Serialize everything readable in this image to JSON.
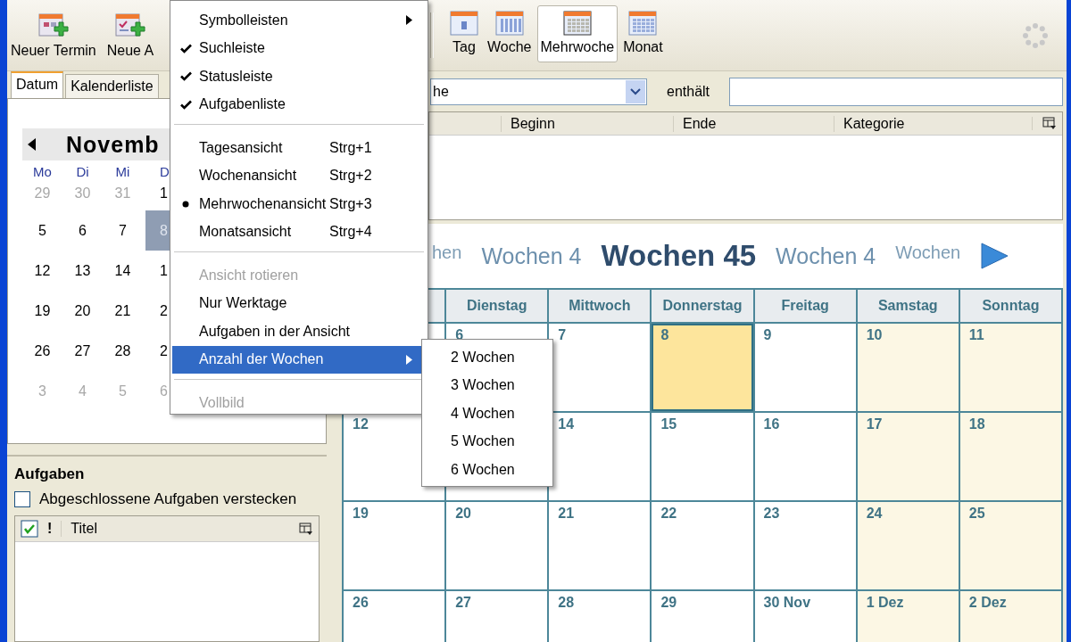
{
  "toolbar": {
    "buttons": [
      {
        "label": "Neuer Termin",
        "selected": false
      },
      {
        "label": "Neue A",
        "selected": false
      }
    ],
    "view_buttons": [
      {
        "label": "Tag",
        "selected": false
      },
      {
        "label": "Woche",
        "selected": false
      },
      {
        "label": "Mehrwoche",
        "selected": true
      },
      {
        "label": "Monat",
        "selected": false
      }
    ]
  },
  "left_tabs": [
    {
      "label": "Datum",
      "selected": true
    },
    {
      "label": "Kalenderliste",
      "selected": false
    }
  ],
  "mini_calendar": {
    "month": "Novemb",
    "weekdays": [
      "Mo",
      "Di",
      "Mi",
      "D"
    ],
    "weeks": [
      [
        {
          "day": "29",
          "other_month": true,
          "selected": false
        },
        {
          "day": "30",
          "other_month": true,
          "selected": false
        },
        {
          "day": "31",
          "other_month": true,
          "selected": false
        },
        {
          "day": "1",
          "other_month": false,
          "selected": false
        }
      ],
      [
        {
          "day": "5",
          "other_month": false,
          "selected": false
        },
        {
          "day": "6",
          "other_month": false,
          "selected": false
        },
        {
          "day": "7",
          "other_month": false,
          "selected": false
        },
        {
          "day": "8",
          "other_month": false,
          "selected": true
        }
      ],
      [
        {
          "day": "12",
          "other_month": false,
          "selected": false
        },
        {
          "day": "13",
          "other_month": false,
          "selected": false
        },
        {
          "day": "14",
          "other_month": false,
          "selected": false
        },
        {
          "day": "1",
          "other_month": false,
          "selected": false
        }
      ],
      [
        {
          "day": "19",
          "other_month": false,
          "selected": false
        },
        {
          "day": "20",
          "other_month": false,
          "selected": false
        },
        {
          "day": "21",
          "other_month": false,
          "selected": false
        },
        {
          "day": "2",
          "other_month": false,
          "selected": false
        }
      ],
      [
        {
          "day": "26",
          "other_month": false,
          "selected": false
        },
        {
          "day": "27",
          "other_month": false,
          "selected": false
        },
        {
          "day": "28",
          "other_month": false,
          "selected": false
        },
        {
          "day": "2",
          "other_month": false,
          "selected": false
        }
      ],
      [
        {
          "day": "3",
          "other_month": true,
          "selected": false
        },
        {
          "day": "4",
          "other_month": true,
          "selected": false
        },
        {
          "day": "5",
          "other_month": true,
          "selected": false
        },
        {
          "day": "6",
          "other_month": true,
          "selected": false
        }
      ]
    ]
  },
  "tasks": {
    "title": "Aufgaben",
    "hide_completed": {
      "label": "Abgeschlossene Aufgaben verstecken",
      "checked": false
    },
    "priority_header": "!",
    "title_header": "Titel"
  },
  "search": {
    "field_value": "he",
    "condition": "enthält"
  },
  "list_columns": [
    "Beginn",
    "Ende",
    "Kategorie"
  ],
  "week_nav": [
    {
      "label": "hen",
      "kind": "far"
    },
    {
      "label": "Wochen 4",
      "kind": "near"
    },
    {
      "label": "Wochen 45",
      "kind": "current"
    },
    {
      "label": "Wochen 4",
      "kind": "near"
    },
    {
      "label": "Wochen",
      "kind": "far"
    }
  ],
  "grid": {
    "weekdays": [
      "Dienstag",
      "Mittwoch",
      "Donnerstag",
      "Freitag",
      "Samstag",
      "Sonntag"
    ],
    "weeks": [
      [
        {
          "weekend": false,
          "today": false
        },
        {
          "day": "6",
          "weekend": false,
          "today": false
        },
        {
          "day": "7",
          "weekend": false,
          "today": false
        },
        {
          "day": "8",
          "weekend": false,
          "today": true
        },
        {
          "day": "9",
          "weekend": false,
          "today": false
        },
        {
          "day": "10",
          "weekend": true,
          "today": false
        },
        {
          "day": "11",
          "weekend": true,
          "today": false
        }
      ],
      [
        {
          "day": "12",
          "weekend": false,
          "today": false
        },
        {
          "weekend": false,
          "today": false
        },
        {
          "day": "14",
          "weekend": false,
          "today": false
        },
        {
          "day": "15",
          "weekend": false,
          "today": false
        },
        {
          "day": "16",
          "weekend": false,
          "today": false
        },
        {
          "day": "17",
          "weekend": true,
          "today": false
        },
        {
          "day": "18",
          "weekend": true,
          "today": false
        }
      ],
      [
        {
          "day": "19",
          "weekend": false,
          "today": false
        },
        {
          "day": "20",
          "weekend": false,
          "today": false
        },
        {
          "day": "21",
          "weekend": false,
          "today": false
        },
        {
          "day": "22",
          "weekend": false,
          "today": false
        },
        {
          "day": "23",
          "weekend": false,
          "today": false
        },
        {
          "day": "24",
          "weekend": true,
          "today": false
        },
        {
          "day": "25",
          "weekend": true,
          "today": false
        }
      ],
      [
        {
          "day": "26",
          "weekend": false,
          "today": false
        },
        {
          "day": "27",
          "weekend": false,
          "today": false
        },
        {
          "day": "28",
          "weekend": false,
          "today": false
        },
        {
          "day": "29",
          "weekend": false,
          "today": false
        },
        {
          "day": "30 Nov",
          "weekend": false,
          "today": false
        },
        {
          "day": "1 Dez",
          "weekend": true,
          "today": false
        },
        {
          "day": "2 Dez",
          "weekend": true,
          "today": false
        }
      ]
    ]
  },
  "menu": {
    "sections": [
      [
        {
          "label": "Symbolleisten",
          "kind": "submenu",
          "disabled": false,
          "highlighted": false
        },
        {
          "label": "Suchleiste",
          "kind": "check",
          "checked": true,
          "disabled": false,
          "highlighted": false
        },
        {
          "label": "Statusleiste",
          "kind": "check",
          "checked": true,
          "disabled": false,
          "highlighted": false
        },
        {
          "label": "Aufgabenliste",
          "kind": "check",
          "checked": true,
          "disabled": false,
          "highlighted": false
        }
      ],
      [
        {
          "label": "Tagesansicht",
          "shortcut": "Strg+1",
          "kind": "radio",
          "checked": false,
          "disabled": false,
          "highlighted": false
        },
        {
          "label": "Wochenansicht",
          "shortcut": "Strg+2",
          "kind": "radio",
          "checked": false,
          "disabled": false,
          "highlighted": false
        },
        {
          "label": "Mehrwochenansicht",
          "shortcut": "Strg+3",
          "kind": "radio",
          "checked": true,
          "disabled": false,
          "highlighted": false
        },
        {
          "label": "Monatsansicht",
          "shortcut": "Strg+4",
          "kind": "radio",
          "checked": false,
          "disabled": false,
          "highlighted": false
        }
      ],
      [
        {
          "label": "Ansicht rotieren",
          "kind": "command",
          "disabled": true,
          "highlighted": false
        },
        {
          "label": "Nur Werktage",
          "kind": "check",
          "checked": false,
          "disabled": false,
          "highlighted": false
        },
        {
          "label": "Aufgaben in der Ansicht",
          "kind": "check",
          "checked": false,
          "disabled": false,
          "highlighted": false
        },
        {
          "label": "Anzahl der Wochen",
          "kind": "submenu",
          "disabled": false,
          "highlighted": true
        }
      ],
      [
        {
          "label": "Vollbild",
          "kind": "command",
          "disabled": true,
          "highlighted": false
        }
      ]
    ]
  },
  "submenu": [
    "2 Wochen",
    "3 Wochen",
    "4 Wochen",
    "5 Wochen",
    "6 Wochen"
  ]
}
